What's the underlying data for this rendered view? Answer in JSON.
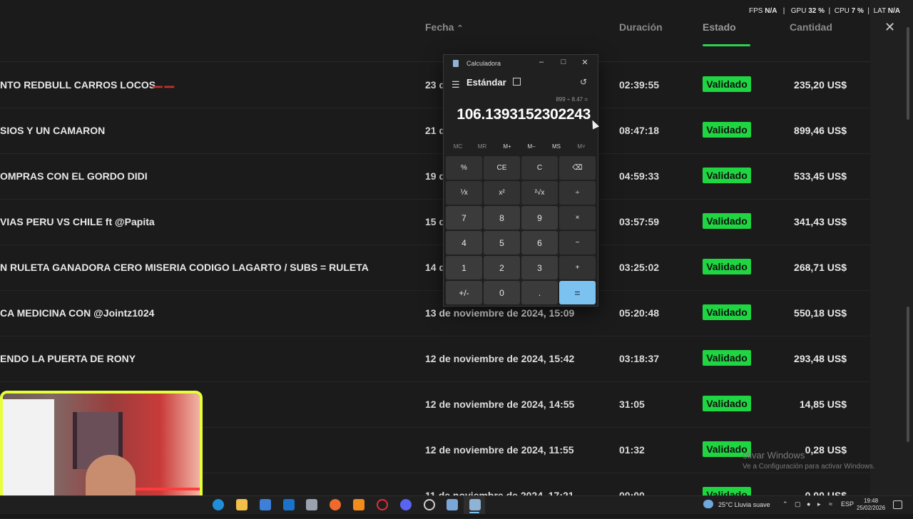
{
  "table": {
    "headers": {
      "fecha": "Fecha",
      "duracion": "Duración",
      "estado": "Estado",
      "cantidad": "Cantidad"
    },
    "sort_indicator": "^",
    "rows": [
      {
        "title": "NTO REDBULL CARROS LOCOS",
        "date": "23 d",
        "duration": "02:39:55",
        "status": "Validado",
        "amount": "235,20 US$"
      },
      {
        "title": "SIOS Y UN CAMARON",
        "date": "21 d",
        "duration": "08:47:18",
        "status": "Validado",
        "amount": "899,46 US$"
      },
      {
        "title": "OMPRAS CON EL GORDO DIDI",
        "date": "19 d",
        "duration": "04:59:33",
        "status": "Validado",
        "amount": "533,45 US$"
      },
      {
        "title": "VIAS PERU VS CHILE ft @Papita",
        "date": "15 d",
        "duration": "03:57:59",
        "status": "Validado",
        "amount": "341,43 US$"
      },
      {
        "title": "N RULETA GANADORA CERO MISERIA CODIGO LAGARTO / SUBS = RULETA",
        "date": "14 d",
        "duration": "03:25:02",
        "status": "Validado",
        "amount": "268,71 US$"
      },
      {
        "title": "CA MEDICINA CON @Jointz1024",
        "date": "13 de noviembre de 2024, 15:09",
        "duration": "05:20:48",
        "status": "Validado",
        "amount": "550,18 US$"
      },
      {
        "title": "ENDO LA PUERTA DE RONY",
        "date": "12 de noviembre de 2024, 15:42",
        "duration": "03:18:37",
        "status": "Validado",
        "amount": "293,48 US$"
      },
      {
        "title": "",
        "date": "12 de noviembre de 2024, 14:55",
        "duration": "31:05",
        "status": "Validado",
        "amount": "14,85 US$"
      },
      {
        "title": "",
        "date": "12 de noviembre de 2024, 11:55",
        "duration": "01:32",
        "status": "Validado",
        "amount": "0,28 US$"
      },
      {
        "title": "",
        "date": "11 de noviembre de 2024, 17:21",
        "duration": "00:00",
        "status": "Validado",
        "amount": "0,00 US$"
      }
    ]
  },
  "overlay": {
    "fps_label": "FPS",
    "fps_value": "N/A",
    "gpu_label": "GPU",
    "gpu_value": "32 %",
    "cpu_label": "CPU",
    "cpu_value": "7 %",
    "lat_label": "LAT",
    "lat_value": "N/A"
  },
  "calculator": {
    "window_title": "Calculadora",
    "mode": "Estándar",
    "expression": "899 ÷ 8.47 =",
    "display": "106.1393152302243",
    "memory": [
      "MC",
      "MR",
      "M+",
      "M–",
      "MS",
      "M˅"
    ],
    "keys": [
      "%",
      "CE",
      "C",
      "⌫",
      "⅟x",
      "x²",
      "²√x",
      "÷",
      "7",
      "8",
      "9",
      "×",
      "4",
      "5",
      "6",
      "−",
      "1",
      "2",
      "3",
      "+",
      "+/-",
      "0",
      ".",
      "="
    ]
  },
  "watermark": {
    "line1": "ctivar Windows",
    "line2": "Ve a Configuración para activar Windows."
  },
  "taskbar": {
    "weather": "25°C  Lluvia suave",
    "language": "ESP",
    "time": "19:48",
    "date": "25/02/2026"
  }
}
